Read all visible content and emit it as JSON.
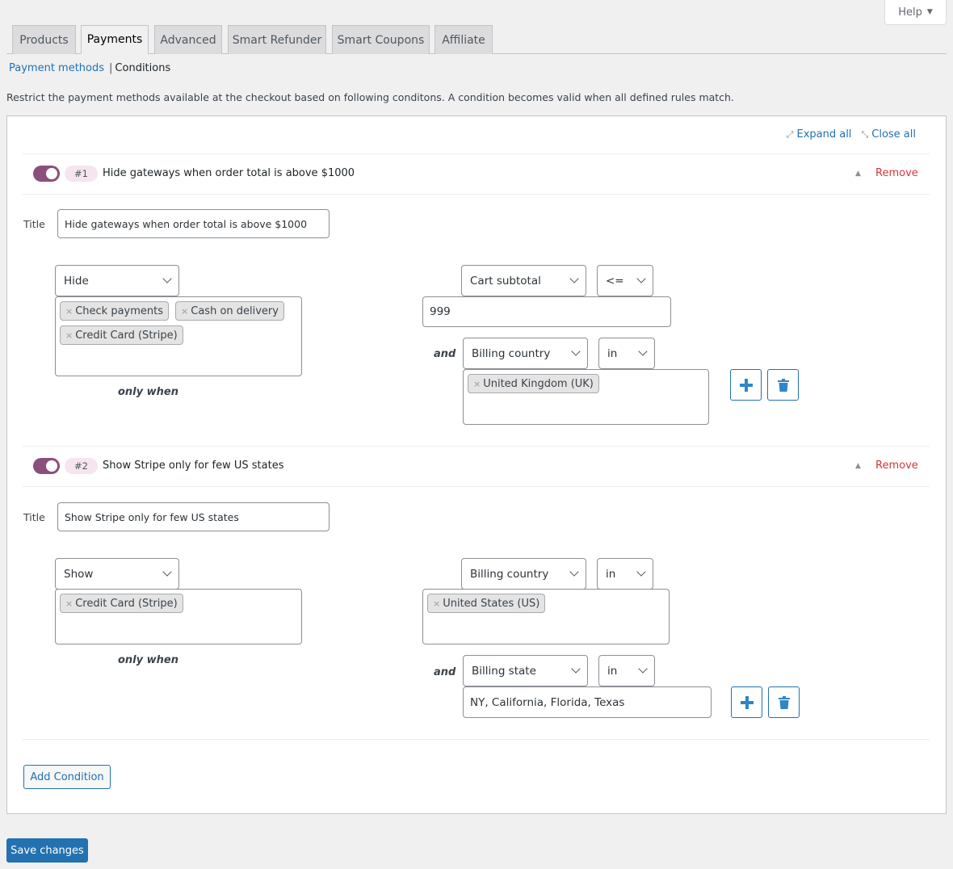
{
  "help": {
    "label": "Help",
    "caret_icon": "triangle-down"
  },
  "tabs": [
    {
      "label": "Products",
      "active": false
    },
    {
      "label": "Payments",
      "active": true
    },
    {
      "label": "Advanced",
      "active": false
    },
    {
      "label": "Smart Refunder",
      "active": false
    },
    {
      "label": "Smart Coupons",
      "active": false
    },
    {
      "label": "Affiliate",
      "active": false
    }
  ],
  "subnav": {
    "link": "Payment methods",
    "separator": "|",
    "current": "Conditions"
  },
  "description": "Restrict the payment methods available at the checkout based on following conditons. A condition becomes valid when all defined rules match.",
  "panel": {
    "expand_all": "Expand all",
    "close_all": "Close all"
  },
  "conditions": [
    {
      "enabled": true,
      "number": "#1",
      "header_title": "Hide gateways when order total is above $1000",
      "remove_label": "Remove",
      "title_label": "Title",
      "title_value": "Hide gateways when order total is above $1000",
      "action": "Hide",
      "gateways": [
        "Check payments",
        "Cash on delivery",
        "Credit Card (Stripe)"
      ],
      "only_when": "only when",
      "rules": [
        {
          "field": "Cart subtotal",
          "operator": "<=",
          "value": "999"
        },
        {
          "connector": "and",
          "field": "Billing country",
          "operator": "in",
          "values": [
            "United Kingdom (UK)"
          ]
        }
      ]
    },
    {
      "enabled": true,
      "number": "#2",
      "header_title": "Show Stripe only for few US states",
      "remove_label": "Remove",
      "title_label": "Title",
      "title_value": "Show Stripe only for few US states",
      "action": "Show",
      "gateways": [
        "Credit Card (Stripe)"
      ],
      "only_when": "only when",
      "rules": [
        {
          "field": "Billing country",
          "operator": "in",
          "values": [
            "United States (US)"
          ]
        },
        {
          "connector": "and",
          "field": "Billing state",
          "operator": "in",
          "value": "NY, California, Florida, Texas"
        }
      ]
    }
  ],
  "add_condition": "Add Condition",
  "save_changes": "Save changes",
  "colors": {
    "accent": "#2271b1",
    "toggle": "#8b4f7d",
    "remove": "#d63638",
    "badge_bg": "#f6e5ef"
  }
}
